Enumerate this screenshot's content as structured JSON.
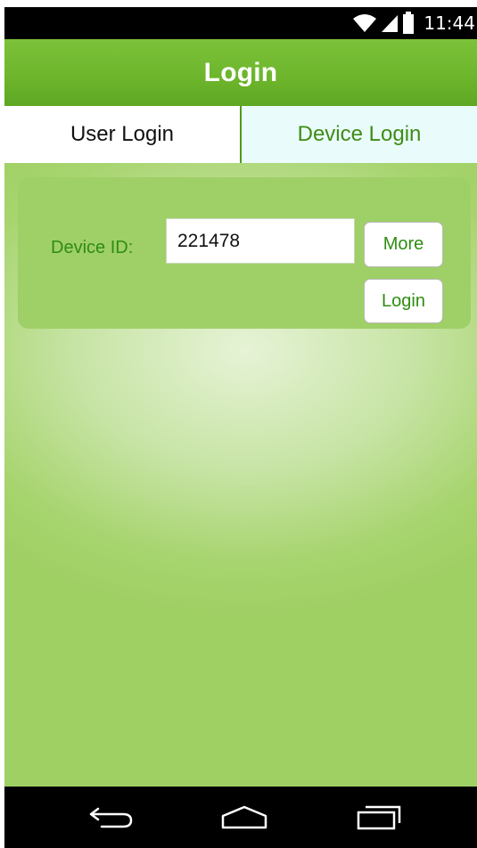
{
  "status_bar": {
    "time": "11:44",
    "icons": [
      "wifi-icon",
      "signal-icon",
      "battery-icon"
    ]
  },
  "action_bar": {
    "title": "Login"
  },
  "tabs": [
    {
      "label": "User Login",
      "selected": false
    },
    {
      "label": "Device Login",
      "selected": true
    }
  ],
  "form": {
    "device_id_label": "Device ID:",
    "device_id_value": "221478",
    "more_button": "More",
    "login_button": "Login"
  },
  "nav_bar": {
    "icons": [
      "back-icon",
      "home-icon",
      "recents-icon"
    ]
  },
  "colors": {
    "action_bar": "#6cb52b",
    "accent_text": "#2f8d12",
    "card": "#9fcf67"
  }
}
